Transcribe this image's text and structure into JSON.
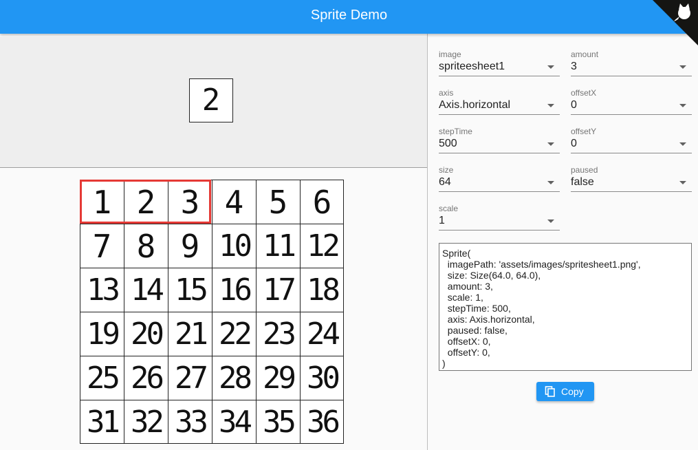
{
  "app": {
    "title": "Sprite Demo",
    "brand_color": "#2196f3",
    "corner_icon": "github-cat-icon"
  },
  "preview": {
    "value": "2"
  },
  "spritesheet": {
    "cells": [
      "1",
      "2",
      "3",
      "4",
      "5",
      "6",
      "7",
      "8",
      "9",
      "10",
      "11",
      "12",
      "13",
      "14",
      "15",
      "16",
      "17",
      "18",
      "19",
      "20",
      "21",
      "22",
      "23",
      "24",
      "25",
      "26",
      "27",
      "28",
      "29",
      "30",
      "31",
      "32",
      "33",
      "34",
      "35",
      "36"
    ],
    "highlight_color": "#e53935"
  },
  "form": {
    "image": {
      "label": "image",
      "value": "spriteesheet1"
    },
    "amount": {
      "label": "amount",
      "value": "3"
    },
    "axis": {
      "label": "axis",
      "value": "Axis.horizontal"
    },
    "offsetX": {
      "label": "offsetX",
      "value": "0"
    },
    "stepTime": {
      "label": "stepTime",
      "value": "500"
    },
    "offsetY": {
      "label": "offsetY",
      "value": "0"
    },
    "size": {
      "label": "size",
      "value": "64"
    },
    "paused": {
      "label": "paused",
      "value": "false"
    },
    "scale": {
      "label": "scale",
      "value": "1"
    }
  },
  "code": "Sprite(\n  imagePath: 'assets/images/spritesheet1.png',\n  size: Size(64.0, 64.0),\n  amount: 3,\n  scale: 1,\n  stepTime: 500,\n  axis: Axis.horizontal,\n  paused: false,\n  offsetX: 0,\n  offsetY: 0,\n)",
  "copy_button": {
    "label": "Copy",
    "icon": "copy-icon"
  }
}
